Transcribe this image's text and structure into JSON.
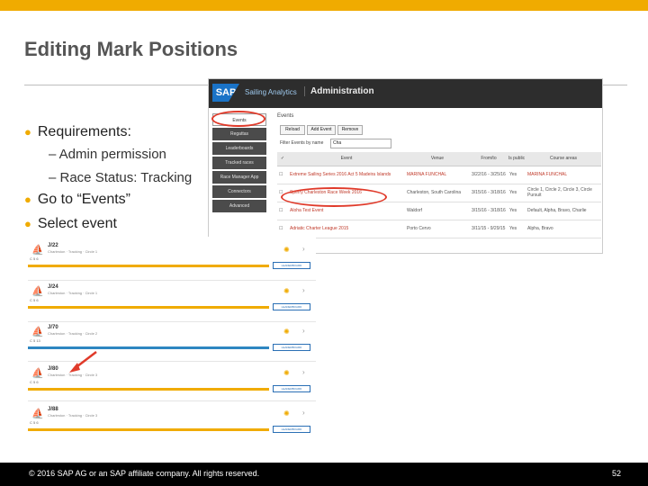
{
  "slide": {
    "title": "Editing Mark Positions",
    "bullets": {
      "b1": "Requirements:",
      "s1": "– Admin permission",
      "s2": "– Race Status: Tracking",
      "b2": "Go to “Events”",
      "b3": "Select event"
    }
  },
  "admin": {
    "app_name": "Sailing Analytics",
    "title": "Administration",
    "logo": "SAP",
    "nav": [
      "Events",
      "Regattas",
      "Leaderboards",
      "Tracked races",
      "Race Manager App",
      "Connectors",
      "Advanced"
    ],
    "events_label": "Events",
    "toolbar": [
      "Reload",
      "Add Event",
      "Remove"
    ],
    "filter_label": "Filter Events by name",
    "filter_value": "Cha",
    "columns": [
      "✓",
      "Event",
      "Venue",
      "From/to",
      "Is public",
      "Course areas"
    ],
    "rows": [
      [
        "",
        "Extreme Sailing Series 2016 Act 5 Madeira Islands",
        "MARINA FUNCHAL",
        "3/22/16 - 3/25/16",
        "Yes",
        "MARINA FUNCHAL"
      ],
      [
        "",
        "Sperry Charleston Race Week 2016",
        "Charleston, South Carolina",
        "3/15/16 - 3/18/16",
        "Yes",
        "Circle 1, Circle 2, Circle 3, Circle Pursuit"
      ],
      [
        "",
        "Aloha Test Event",
        "Waldorf",
        "3/15/16 - 3/18/16",
        "Yes",
        "Default, Alpha, Bravo, Charlie"
      ],
      [
        "",
        "Adriatic Charter League 2015",
        "Porto Cervo",
        "3/11/15 - 9/29/15",
        "Yes",
        "Alpha, Bravo"
      ]
    ]
  },
  "regattas": [
    {
      "name": "J/22",
      "sub": "Charleston · Tracking · Circle 1",
      "meta": "C  5  6",
      "bar": "yellow",
      "button": "LEADERBOARD"
    },
    {
      "name": "J/24",
      "sub": "Charleston · Tracking · Circle 1",
      "meta": "C  5  6",
      "bar": "yellow",
      "button": "LEADERBOARD"
    },
    {
      "name": "J/70",
      "sub": "Charleston · Tracking · Circle 2",
      "meta": "C  5  13",
      "bar": "blue",
      "button": "LEADERBOARD"
    },
    {
      "name": "J/80",
      "sub": "Charleston · Tracking · Circle 3",
      "meta": "C  5  6",
      "bar": "yellow",
      "button": "LEADERBOARD"
    },
    {
      "name": "J/88",
      "sub": "Charleston · Tracking · Circle 3",
      "meta": "C  5  6",
      "bar": "yellow",
      "button": "LEADERBOARD"
    }
  ],
  "footer": {
    "copyright": "© 2016 SAP AG or an SAP affiliate company. All rights reserved.",
    "page": "52"
  },
  "colors": {
    "accent": "#f0ab00",
    "highlight": "#e03a2a",
    "link": "#2a6fb5"
  }
}
